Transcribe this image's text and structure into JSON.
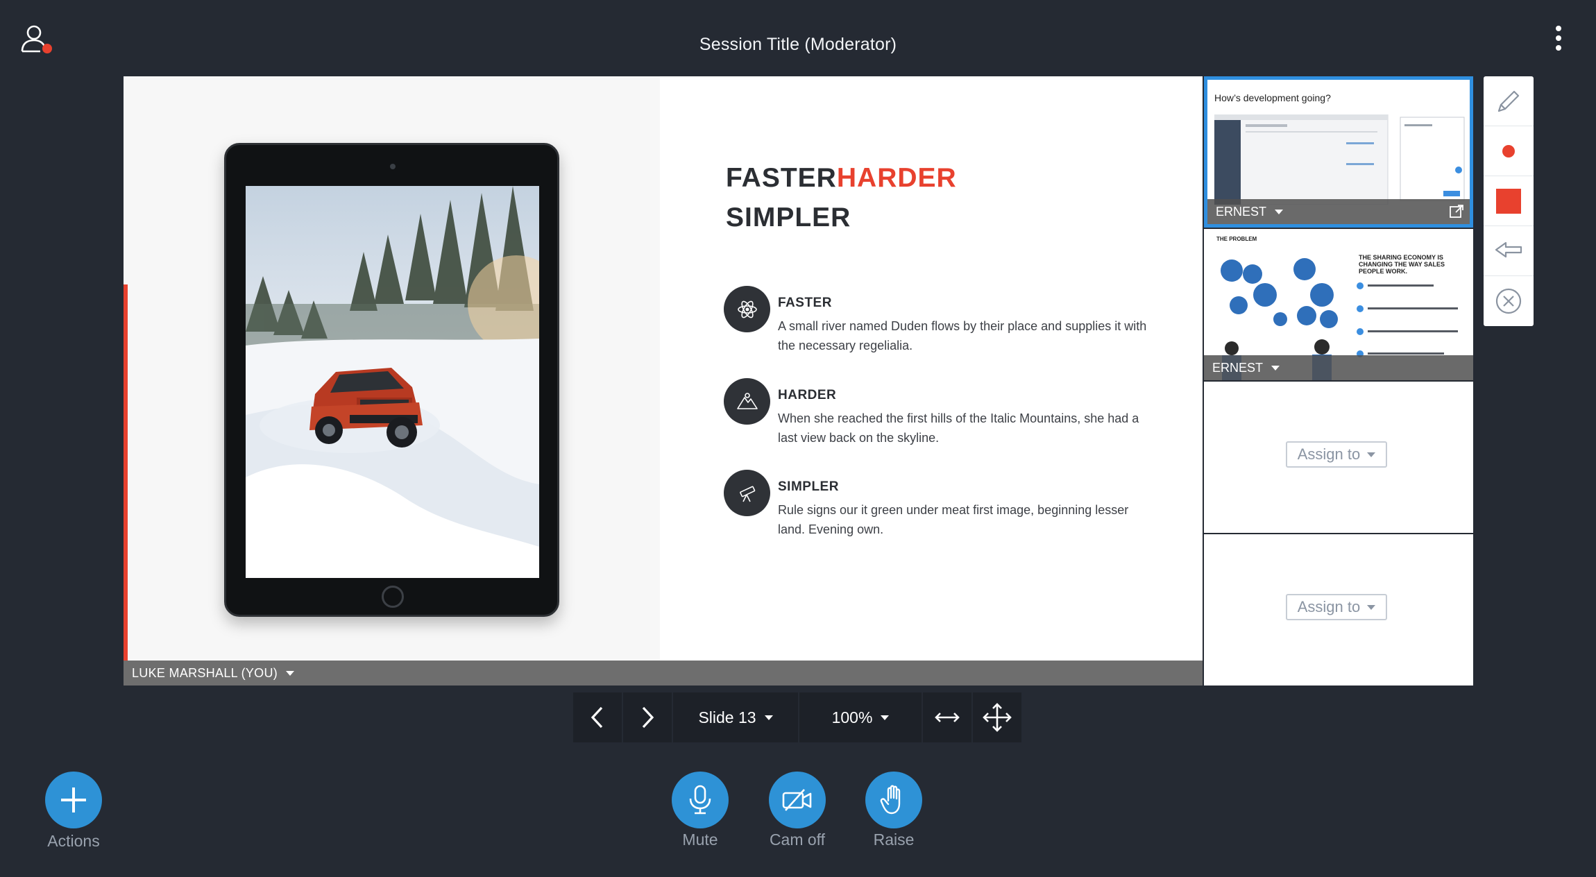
{
  "header": {
    "title": "Session Title (Moderator)"
  },
  "slide": {
    "headline_part1": "FASTER",
    "headline_part2": "HARDER",
    "headline_line2": "SIMPLER",
    "features": [
      {
        "title": "FASTER",
        "description": "A small river named Duden flows by their place and supplies it with the necessary regelialia."
      },
      {
        "title": "HARDER",
        "description": "When she reached the first hills of the Italic Mountains, she had a last view back on the skyline."
      },
      {
        "title": "SIMPLER",
        "description": "Rule signs our it green under meat first image, beginning lesser land. Evening own."
      }
    ],
    "presenter": "LUKE MARSHALL (YOU)"
  },
  "thumbnails": [
    {
      "title": "How’s development going?",
      "user": "ERNEST"
    },
    {
      "title": "THE PROBLEM",
      "subtitle_lines": [
        "THE SHARING ECONOMY IS",
        "CHANGING THE WAY SALES",
        "PEOPLE WORK."
      ],
      "user": "ERNEST"
    },
    {
      "assign_label": "Assign to"
    },
    {
      "assign_label": "Assign to"
    }
  ],
  "controls": {
    "slide_label": "Slide 13",
    "zoom_label": "100%"
  },
  "actions": {
    "actions_label": "Actions",
    "mute_label": "Mute",
    "cam_label": "Cam off",
    "raise_label": "Raise"
  },
  "colors": {
    "background": "#252a33",
    "accent_red": "#e8412e",
    "accent_blue": "#2e92d6",
    "active_thumb_border": "#2f8fe0"
  }
}
